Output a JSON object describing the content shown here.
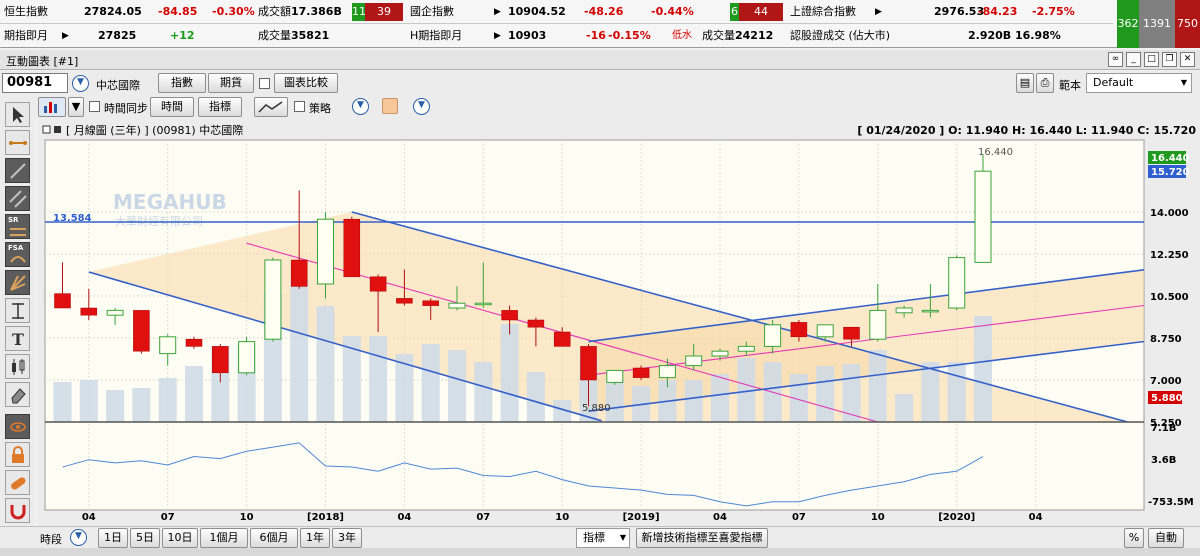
{
  "ticker": {
    "row1": {
      "hsi_label": "恒生指數",
      "hsi_value": "27824.05",
      "hsi_change": "-84.85",
      "hsi_pct": "-0.30%",
      "turnover_label": "成交額",
      "turnover_value": "17.386B",
      "up_count": "11",
      "down_count": "39",
      "hscei_label": "國企指數",
      "hscei_value": "10904.52",
      "hscei_change": "-48.26",
      "hscei_pct": "-0.44%",
      "hscei_up": "6",
      "hscei_down": "44",
      "sse_label": "上證綜合指數",
      "sse_value": "2976.53",
      "sse_change": "-84.23",
      "sse_pct": "-2.75%"
    },
    "row2": {
      "fut_label": "期指即月",
      "fut_value": "27825",
      "fut_change": "+12",
      "vol_label": "成交量",
      "vol_value": "35821",
      "hfut_label": "H期指即月",
      "hfut_value": "10903",
      "hfut_change": "-16",
      "hfut_pct": "-0.15%",
      "hfut_status": "低水",
      "hfut_vol_label": "成交量",
      "hfut_vol_value": "24212",
      "warrant_label": "認股證成交 (佔大市)",
      "warrant_value": "2.920B",
      "warrant_pct": "16.98%"
    },
    "breadth": {
      "up": "362",
      "flat": "1391",
      "down": "750"
    }
  },
  "window": {
    "title": "互動圖表 [#1]"
  },
  "toolbar": {
    "symbol": "00981",
    "stock_name": "中芯國際",
    "btn_index": "指數",
    "btn_futures": "期貨",
    "btn_compare": "圖表比較",
    "template_label": "範本",
    "template_value": "Default",
    "time_sync_label": "時間同步",
    "btn_time": "時間",
    "btn_indicator": "指標",
    "strategy_label": "策略"
  },
  "tools": {
    "sr": "SR",
    "fsa": "FSA"
  },
  "chart": {
    "header_left": "[ 月線圖 (三年) ]  (00981)  中芯國際",
    "header_right": "[ 01/24/2020 ]  O: 11.940  H: 16.440  L: 11.940  C: 15.720",
    "watermark": "MEGAHUB",
    "watermark_sub": "大華財經有限公司",
    "level_high_label": "13.584",
    "level_low_label": "5.880",
    "peak_label": "16.440",
    "price_badges": [
      {
        "text": "16.440",
        "color": "#1f9a1f"
      },
      {
        "text": "15.720",
        "color": "#2f5fd0"
      },
      {
        "text": "5.880",
        "color": "#d40000"
      }
    ],
    "volume_axis": [
      "7.1B",
      "3.6B",
      "-753.5M"
    ]
  },
  "chart_data": {
    "type": "candlestick",
    "title": "[ 月線圖 (三年) ]  (00981)  中芯國際",
    "price_axis_ticks": [
      "14.000",
      "12.250",
      "10.500",
      "8.750",
      "7.000",
      "5.250"
    ],
    "ylim": [
      5.25,
      17.0
    ],
    "x_tick_labels": [
      "04",
      "07",
      "10",
      "[2018]",
      "04",
      "07",
      "10",
      "[2019]",
      "04",
      "07",
      "10",
      "[2020]",
      "04"
    ],
    "candles": [
      {
        "o": 10.6,
        "h": 11.9,
        "l": 10.0,
        "c": 10.0
      },
      {
        "o": 10.0,
        "h": 10.8,
        "l": 9.5,
        "c": 9.7
      },
      {
        "o": 9.7,
        "h": 10.0,
        "l": 9.3,
        "c": 9.9
      },
      {
        "o": 9.9,
        "h": 9.9,
        "l": 8.1,
        "c": 8.2
      },
      {
        "o": 8.1,
        "h": 8.9,
        "l": 7.6,
        "c": 8.8
      },
      {
        "o": 8.7,
        "h": 8.8,
        "l": 8.3,
        "c": 8.4
      },
      {
        "o": 8.4,
        "h": 8.5,
        "l": 6.9,
        "c": 7.3
      },
      {
        "o": 7.3,
        "h": 8.8,
        "l": 7.2,
        "c": 8.6
      },
      {
        "o": 8.7,
        "h": 12.1,
        "l": 8.6,
        "c": 12.0
      },
      {
        "o": 12.0,
        "h": 14.9,
        "l": 10.8,
        "c": 10.9
      },
      {
        "o": 11.0,
        "h": 14.0,
        "l": 10.4,
        "c": 13.7
      },
      {
        "o": 13.7,
        "h": 13.8,
        "l": 11.3,
        "c": 11.3
      },
      {
        "o": 11.3,
        "h": 11.4,
        "l": 9.0,
        "c": 10.7
      },
      {
        "o": 10.4,
        "h": 11.6,
        "l": 10.1,
        "c": 10.2
      },
      {
        "o": 10.3,
        "h": 10.4,
        "l": 9.5,
        "c": 10.1
      },
      {
        "o": 10.0,
        "h": 10.9,
        "l": 9.9,
        "c": 10.2
      },
      {
        "o": 10.2,
        "h": 11.9,
        "l": 10.0,
        "c": 10.2
      },
      {
        "o": 9.9,
        "h": 10.1,
        "l": 8.9,
        "c": 9.5
      },
      {
        "o": 9.5,
        "h": 9.6,
        "l": 8.4,
        "c": 9.2
      },
      {
        "o": 9.0,
        "h": 9.2,
        "l": 8.4,
        "c": 8.4
      },
      {
        "o": 8.4,
        "h": 8.5,
        "l": 5.9,
        "c": 7.0
      },
      {
        "o": 6.9,
        "h": 7.4,
        "l": 6.8,
        "c": 7.4
      },
      {
        "o": 7.5,
        "h": 7.6,
        "l": 7.0,
        "c": 7.1
      },
      {
        "o": 7.1,
        "h": 7.9,
        "l": 6.7,
        "c": 7.6
      },
      {
        "o": 7.6,
        "h": 8.5,
        "l": 7.4,
        "c": 8.0
      },
      {
        "o": 8.0,
        "h": 8.3,
        "l": 7.8,
        "c": 8.2
      },
      {
        "o": 8.2,
        "h": 8.6,
        "l": 8.0,
        "c": 8.4
      },
      {
        "o": 8.4,
        "h": 9.5,
        "l": 8.1,
        "c": 9.3
      },
      {
        "o": 9.4,
        "h": 9.5,
        "l": 8.6,
        "c": 8.8
      },
      {
        "o": 8.8,
        "h": 9.3,
        "l": 8.6,
        "c": 9.3
      },
      {
        "o": 9.2,
        "h": 9.2,
        "l": 8.4,
        "c": 8.7
      },
      {
        "o": 8.7,
        "h": 11.0,
        "l": 8.6,
        "c": 9.9
      },
      {
        "o": 9.8,
        "h": 10.1,
        "l": 9.6,
        "c": 10.0
      },
      {
        "o": 9.9,
        "h": 11.0,
        "l": 9.6,
        "c": 9.9
      },
      {
        "o": 10.0,
        "h": 12.2,
        "l": 9.9,
        "c": 12.1
      },
      {
        "o": 11.9,
        "h": 16.4,
        "l": 11.9,
        "c": 15.7
      }
    ],
    "volumes": [
      2.0,
      2.1,
      1.6,
      1.7,
      2.2,
      2.8,
      3.8,
      3.9,
      6.5,
      7.1,
      5.8,
      4.3,
      4.3,
      3.4,
      3.9,
      3.6,
      3.0,
      4.9,
      2.5,
      1.1,
      3.3,
      2.1,
      1.8,
      2.1,
      2.1,
      2.4,
      3.2,
      3.0,
      2.4,
      2.8,
      2.9,
      3.6,
      1.4,
      3.0,
      3.0,
      5.3
    ],
    "indicator": [
      -0.1,
      0.6,
      0.3,
      0.5,
      0.1,
      0.9,
      0.7,
      1.4,
      1.8,
      2.2,
      0.0,
      -0.1,
      -0.5,
      0.3,
      -0.3,
      -0.2,
      -0.9,
      -1.0,
      -0.5,
      -1.3,
      -1.9,
      -2.1,
      -2.3,
      -2.7,
      -2.8,
      -3.4,
      -3.8,
      -3.4,
      -3.4,
      -2.8,
      -2.3,
      -1.9,
      -1.5,
      -0.8,
      -0.5,
      0.9
    ],
    "level_lines": [
      13.584
    ],
    "channels": {
      "descending_upper": [
        [
          11,
          14.0
        ],
        [
          40.5,
          5.25
        ]
      ],
      "descending_lower": [
        [
          1,
          11.5
        ],
        [
          20.5,
          5.3
        ]
      ],
      "descending_mid": [
        [
          7,
          12.7
        ],
        [
          31,
          5.25
        ]
      ],
      "ascending_upper": [
        [
          20,
          8.6
        ],
        [
          44,
          12.0
        ]
      ],
      "ascending_lower": [
        [
          20,
          5.7
        ],
        [
          44,
          9.0
        ]
      ],
      "ascending_mid": [
        [
          20,
          7.2
        ],
        [
          44,
          10.5
        ]
      ]
    }
  },
  "bottom": {
    "period_label": "時段",
    "periods": [
      "1日",
      "5日",
      "10日",
      "1個月",
      "6個月",
      "1年",
      "3年"
    ],
    "indicator_label": "指標",
    "add_indicator": "新增技術指標至喜愛指標",
    "pct_label": "%",
    "auto_label": "自動"
  }
}
